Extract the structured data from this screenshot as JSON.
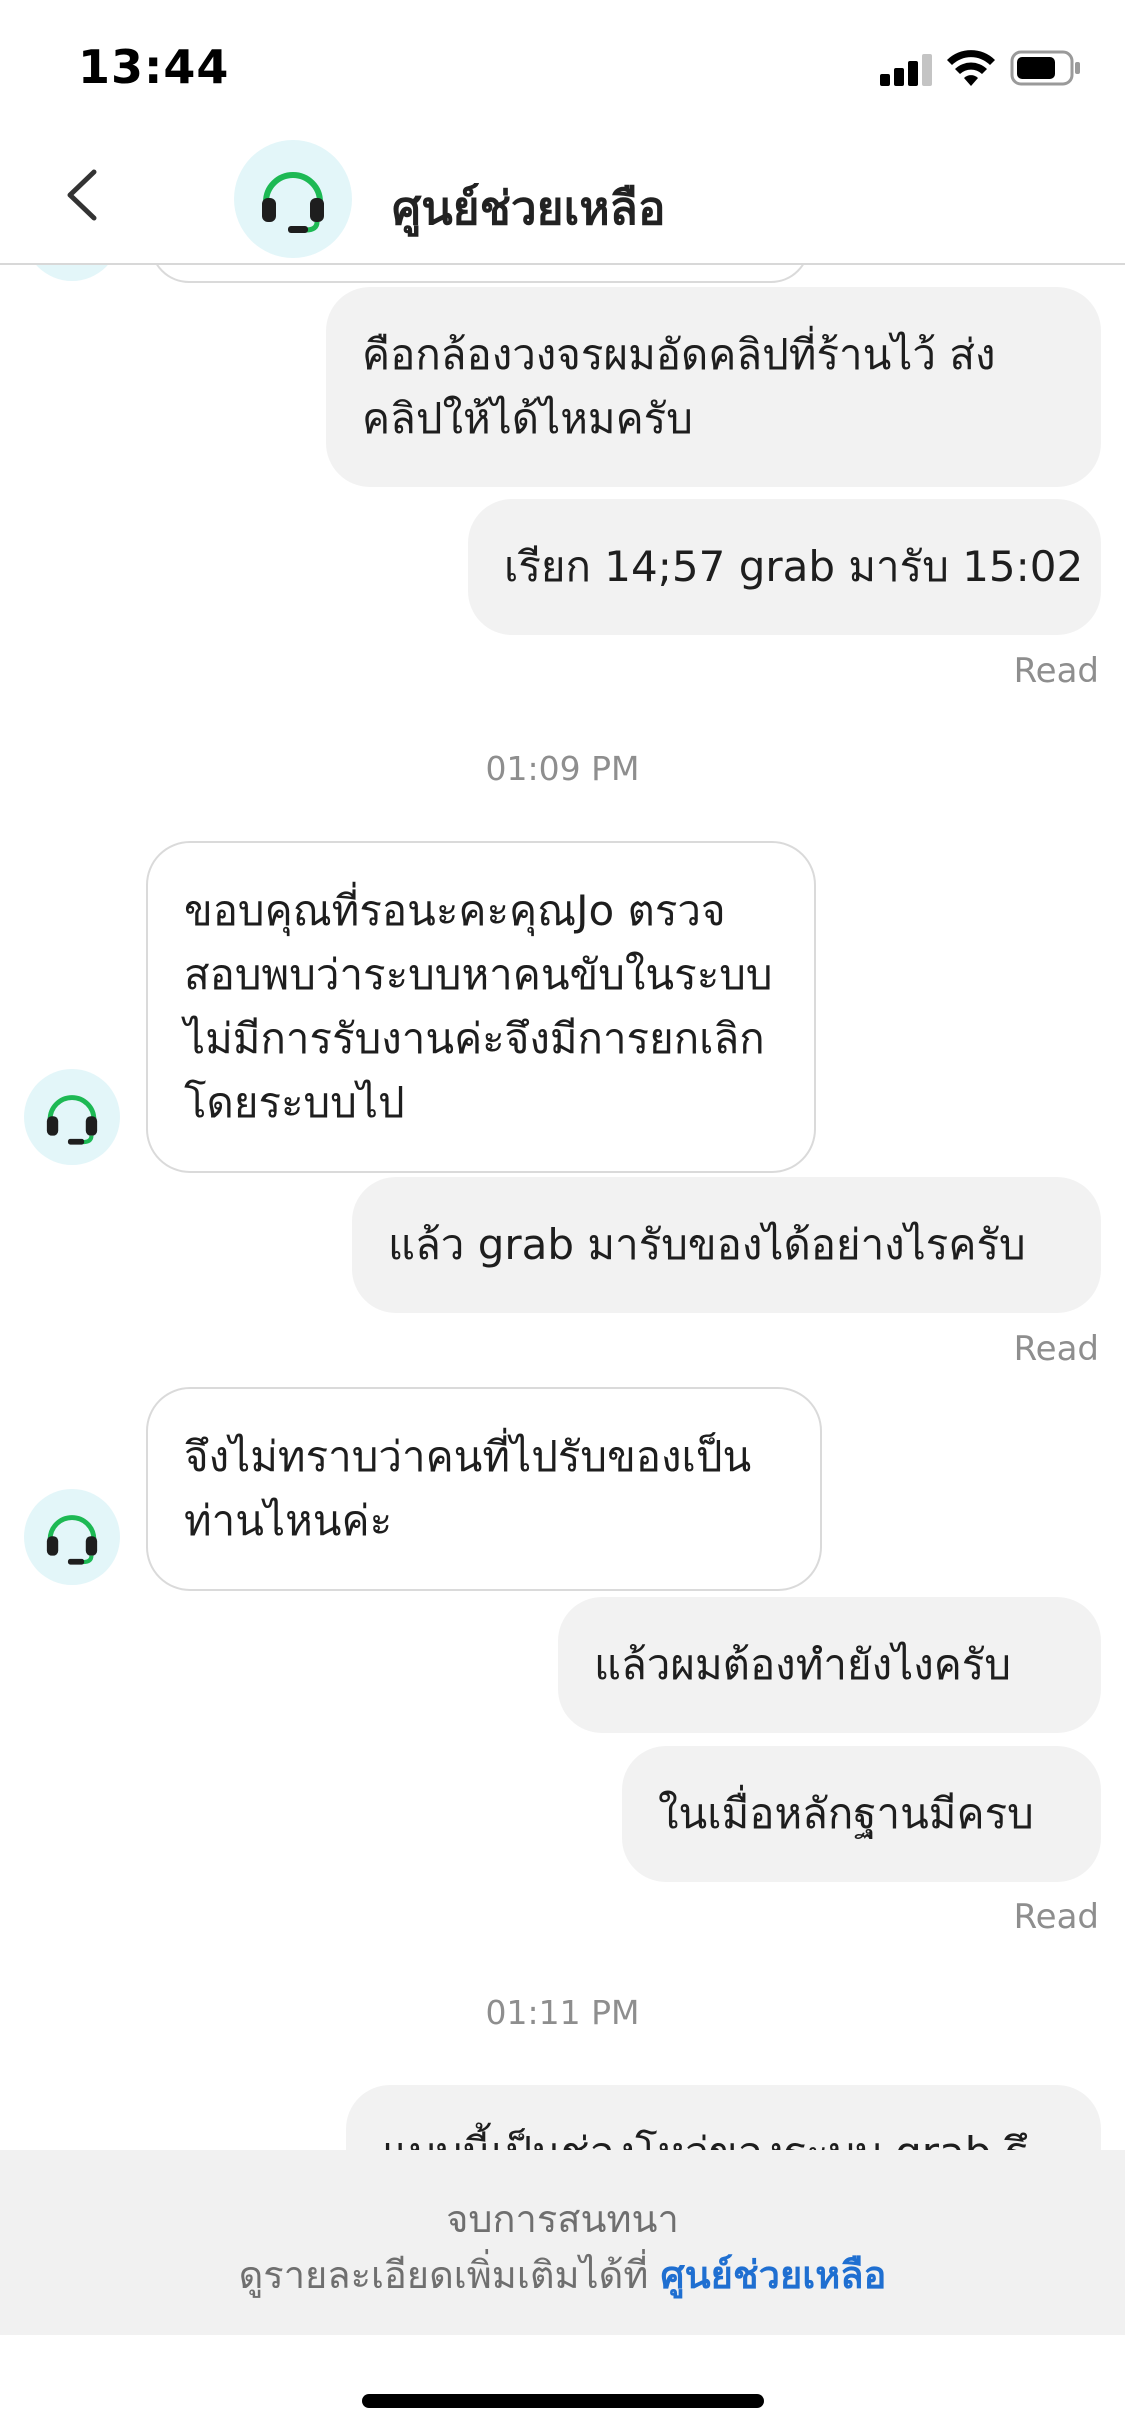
{
  "status_bar": {
    "time": "13:44"
  },
  "header": {
    "title": "ศูนย์ช่วยเหลือ"
  },
  "messages": [
    {
      "text": "คือกล้องวงจรผมอัดคลิปที่ร้านไว้ ส่งคลิปให้ได้ไหมครับ"
    },
    {
      "text": "เรียก 14;57 grab มารับ 15:02",
      "status": "Read"
    },
    {
      "text": "ขอบคุณที่รอนะคะคุณJo ตรวจสอบพบว่าระบบหาคนขับในระบบไม่มีการรับงานค่ะจึงมีการยกเลิกโดยระบบไป"
    },
    {
      "text": "แล้ว grab มารับของได้อย่างไรครับ",
      "status": "Read"
    },
    {
      "text": "จึงไม่ทราบว่าคนที่ไปรับของเป็นท่านไหนค่ะ"
    },
    {
      "text": "แล้วผมต้องทำยังไงครับ"
    },
    {
      "text": "ในเมื่อหลักฐานมีครบ",
      "status": "Read"
    },
    {
      "text": "แบบนี้เป็นช่องโหว่ของระบบ grab รึ"
    }
  ],
  "timestamps": [
    "01:09 PM",
    "01:11 PM"
  ],
  "footer": {
    "ended_text": "จบการสนทนา",
    "more_text": "ดูรายละเอียดเพิ่มเติมได้ที่ ",
    "link_text": "ศูนย์ช่วยเหลือ"
  },
  "colors": {
    "accent_green": "#1db954",
    "link_blue": "#1f6fd1",
    "avatar_bg": "#e3f6f9"
  },
  "icons": [
    "back-icon",
    "headset-icon",
    "signal-icon",
    "wifi-icon",
    "battery-icon"
  ]
}
